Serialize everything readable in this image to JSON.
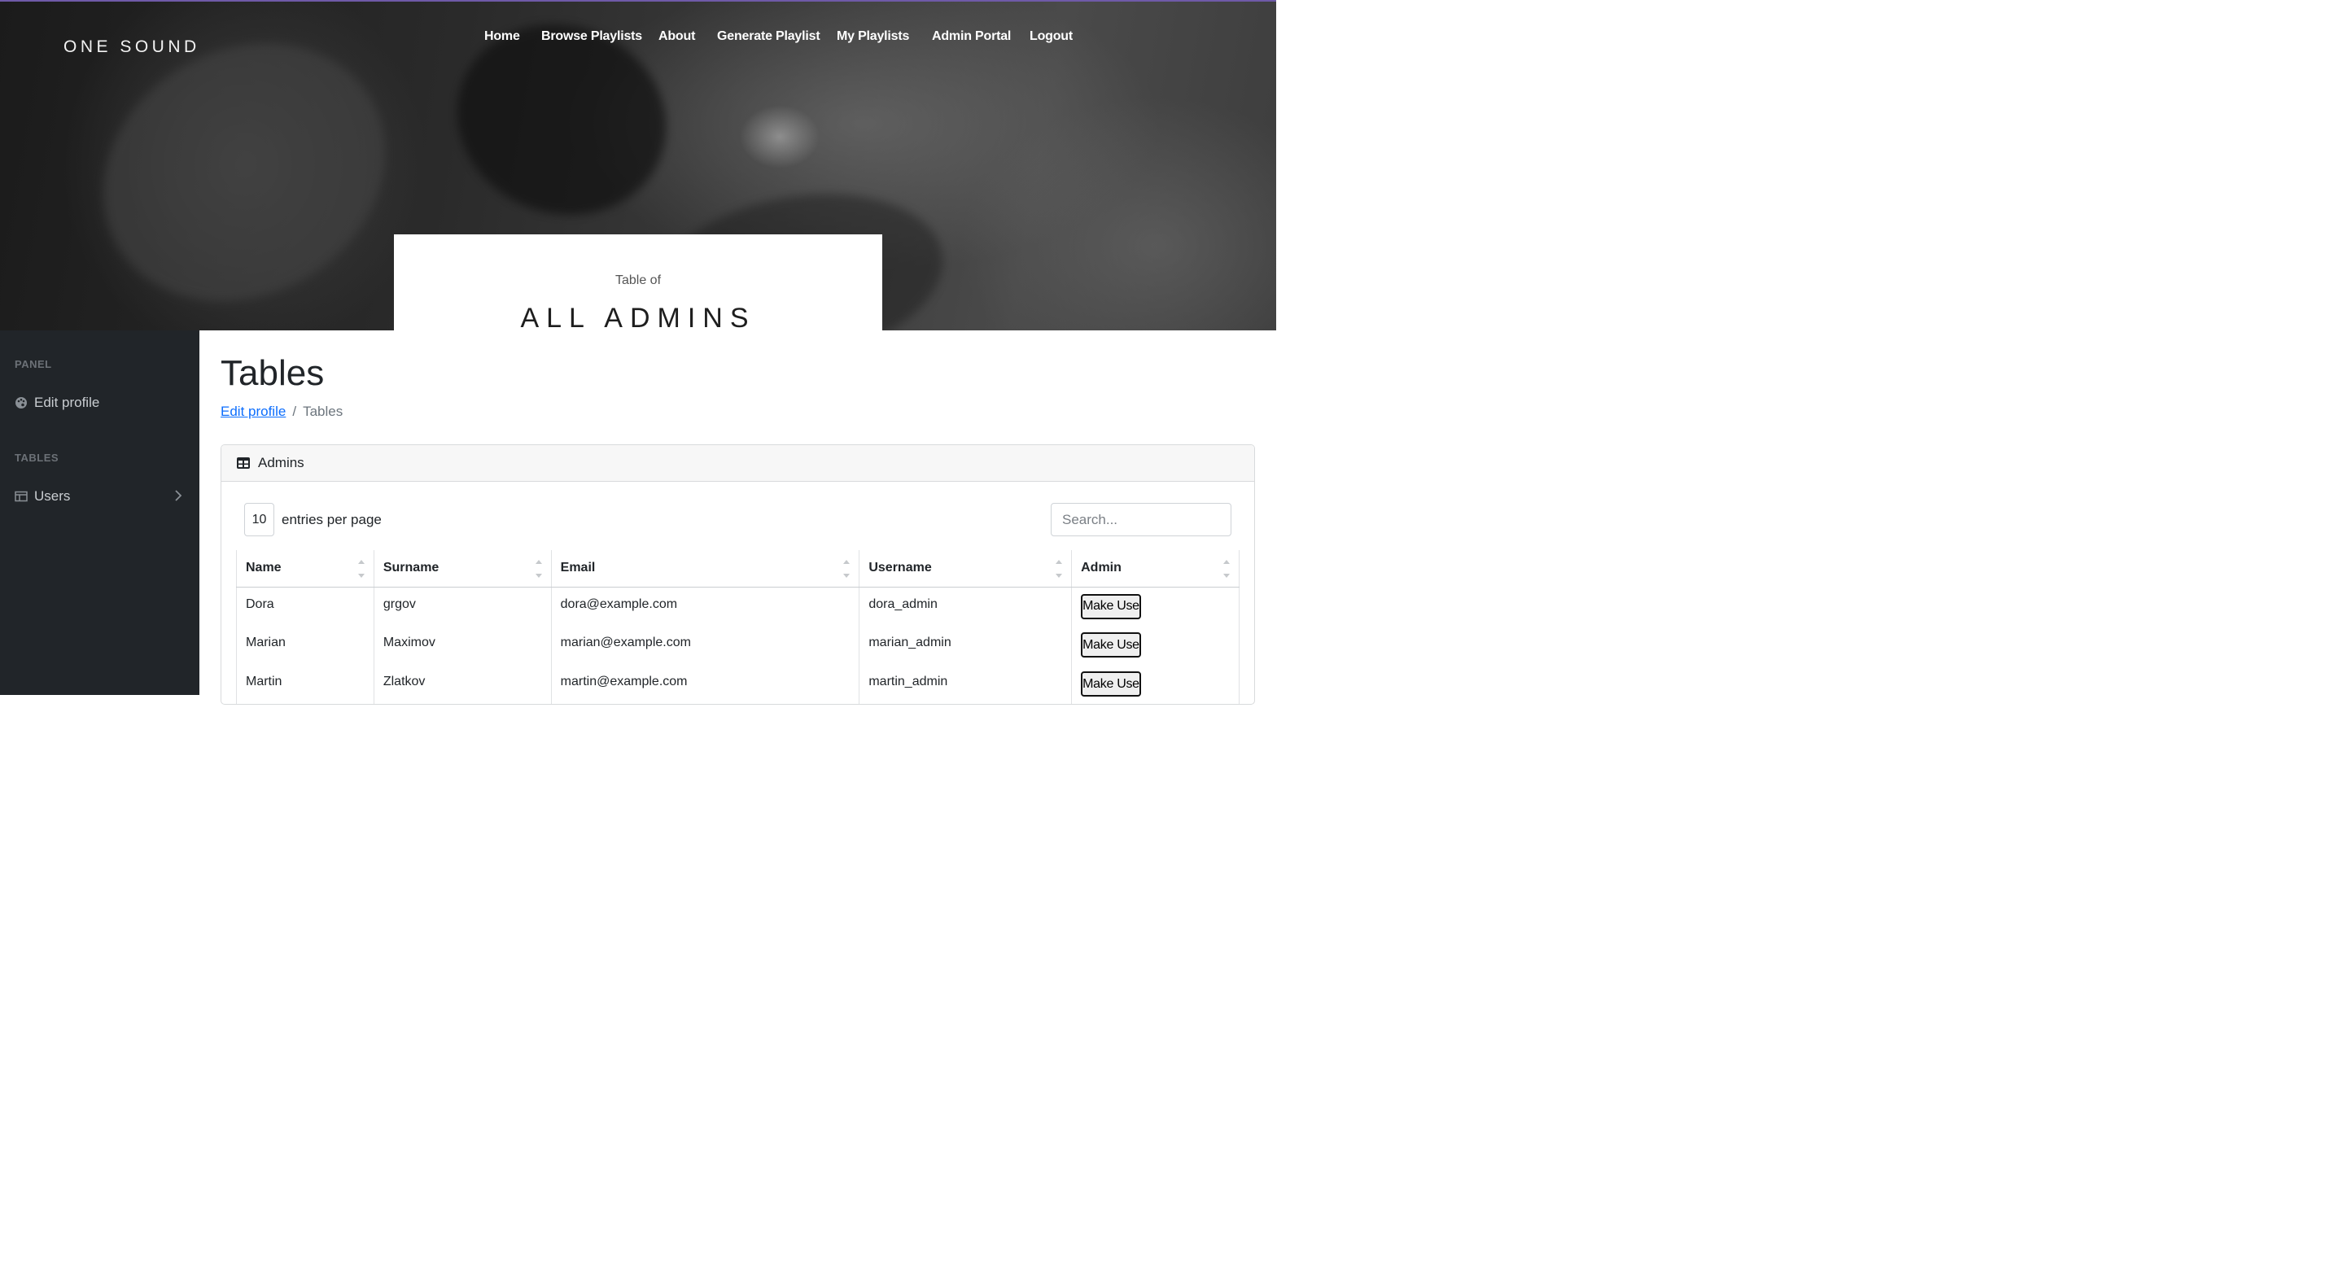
{
  "header": {
    "brand": "ONE SOUND",
    "nav": [
      "Home",
      "Browse Playlists",
      "About",
      "Generate Playlist",
      "My Playlists",
      "Admin Portal",
      "Logout"
    ],
    "title_sub": "Table of",
    "title_main": "ALL ADMINS"
  },
  "sidebar": {
    "panel_heading": "PANEL",
    "edit_profile": "Edit profile",
    "tables_heading": "TABLES",
    "users": "Users"
  },
  "main": {
    "page_title": "Tables",
    "breadcrumb": {
      "link": "Edit profile",
      "separator": "/",
      "current": "Tables"
    },
    "card_title": "Admins",
    "per_page_value": "10",
    "per_page_label": "entries per page",
    "search_placeholder": "Search...",
    "columns": [
      "Name",
      "Surname",
      "Email",
      "Username",
      "Admin"
    ],
    "rows": [
      {
        "name": "Dora",
        "surname": "grgov",
        "email": "dora@example.com",
        "username": "dora_admin",
        "action": "Make User"
      },
      {
        "name": "Marian",
        "surname": "Maximov",
        "email": "marian@example.com",
        "username": "marian_admin",
        "action": "Make User"
      },
      {
        "name": "Martin",
        "surname": "Zlatkov",
        "email": "martin@example.com",
        "username": "martin_admin",
        "action": "Make User"
      }
    ]
  },
  "colors": {
    "sidebar_bg": "#212529",
    "link": "#0d6efd",
    "accent_top_border": "#6f5aa8"
  }
}
